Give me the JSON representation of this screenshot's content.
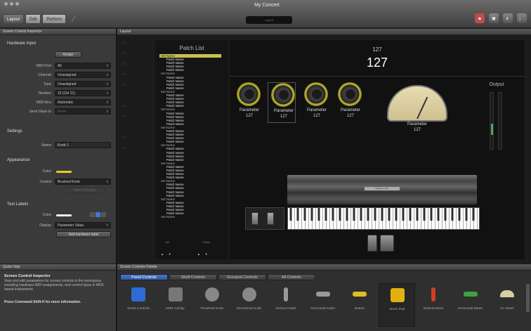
{
  "window": {
    "title": "My Concert",
    "lcd": "Layout"
  },
  "toolbar": {
    "modes": [
      "Layout",
      "Edit",
      "Perform"
    ],
    "active_mode": "Layout"
  },
  "inspector": {
    "title": "Screen Control Inspector",
    "hardware_input": {
      "heading": "Hardware Input",
      "assign_label": "Assign",
      "fields": [
        {
          "label": "MIDI Port:",
          "value": "All"
        },
        {
          "label": "Channel:",
          "value": "Unassigned"
        },
        {
          "label": "Type:",
          "value": "Unassigned"
        },
        {
          "label": "Number:",
          "value": "15 (Ctrl 21)"
        },
        {
          "label": "MIDI thru:",
          "value": "Automatic"
        },
        {
          "label": "Send Value to:",
          "value": "None"
        }
      ]
    },
    "settings": {
      "heading": "Settings",
      "name_label": "Name:",
      "name_value": "Knob 1"
    },
    "appearance": {
      "heading": "Appearance",
      "color_label": "Color:",
      "control_label": "Control:",
      "control_value": "Brushed Knob",
      "sub_button": "Select Display"
    },
    "text_labels": {
      "heading": "Text Labels",
      "color_label": "Color:",
      "display_label": "Display:",
      "display_value": "Parameter Value",
      "add_button": "Add hardware label"
    }
  },
  "layout": {
    "title": "Layout",
    "patch_list": {
      "title": "Patch List",
      "items": [
        {
          "text": "Set Name",
          "kind": "set",
          "selected": true
        },
        {
          "text": "Patch Name",
          "kind": "patch"
        },
        {
          "text": "Patch Name",
          "kind": "patch"
        },
        {
          "text": "Patch Name",
          "kind": "patch"
        },
        {
          "text": "Patch Name",
          "kind": "patch"
        },
        {
          "text": "Set Name",
          "kind": "set"
        },
        {
          "text": "Patch Name",
          "kind": "patch"
        },
        {
          "text": "Patch Name",
          "kind": "patch"
        },
        {
          "text": "Patch Name",
          "kind": "patch"
        },
        {
          "text": "Patch Name",
          "kind": "patch"
        },
        {
          "text": "Set Name",
          "kind": "set"
        },
        {
          "text": "Patch Name",
          "kind": "patch"
        },
        {
          "text": "Patch Name",
          "kind": "patch"
        },
        {
          "text": "Patch Name",
          "kind": "patch"
        },
        {
          "text": "Patch Name",
          "kind": "patch"
        },
        {
          "text": "Set Name",
          "kind": "set"
        },
        {
          "text": "Patch Name",
          "kind": "patch"
        },
        {
          "text": "Patch Name",
          "kind": "patch"
        },
        {
          "text": "Patch Name",
          "kind": "patch"
        },
        {
          "text": "Patch Name",
          "kind": "patch"
        },
        {
          "text": "Set Name",
          "kind": "set"
        },
        {
          "text": "Patch Name",
          "kind": "patch"
        },
        {
          "text": "Patch Name",
          "kind": "patch"
        },
        {
          "text": "Patch Name",
          "kind": "patch"
        },
        {
          "text": "Patch Name",
          "kind": "patch"
        },
        {
          "text": "Set Name",
          "kind": "set"
        },
        {
          "text": "Patch Name",
          "kind": "patch"
        },
        {
          "text": "Patch Name",
          "kind": "patch"
        },
        {
          "text": "Patch Name",
          "kind": "patch"
        },
        {
          "text": "Patch Name",
          "kind": "patch"
        },
        {
          "text": "Set Name",
          "kind": "set"
        },
        {
          "text": "Patch Name",
          "kind": "patch"
        },
        {
          "text": "Patch Name",
          "kind": "patch"
        },
        {
          "text": "Patch Name",
          "kind": "patch"
        },
        {
          "text": "Patch Name",
          "kind": "patch"
        },
        {
          "text": "Set Name",
          "kind": "set"
        },
        {
          "text": "Patch Name",
          "kind": "patch"
        },
        {
          "text": "Patch Name",
          "kind": "patch"
        },
        {
          "text": "Patch Name",
          "kind": "patch"
        },
        {
          "text": "Patch Name",
          "kind": "patch"
        },
        {
          "text": "Set Name",
          "kind": "set"
        },
        {
          "text": "Patch Name",
          "kind": "patch"
        },
        {
          "text": "Patch Name",
          "kind": "patch"
        },
        {
          "text": "Patch Name",
          "kind": "patch"
        },
        {
          "text": "Patch Name",
          "kind": "patch"
        },
        {
          "text": "Set Name",
          "kind": "set"
        }
      ],
      "set_nav_label": "Set",
      "patch_nav_label": "Patch"
    },
    "readout_small": "127",
    "readout_big": "127",
    "knobs": [
      {
        "name": "Parameter",
        "value": "127",
        "selected": false
      },
      {
        "name": "Parameter",
        "value": "127",
        "selected": true
      },
      {
        "name": "Parameter",
        "value": "127",
        "selected": false
      },
      {
        "name": "Parameter",
        "value": "127",
        "selected": false
      }
    ],
    "vu_meter": {
      "name": "Parameter",
      "value": "127"
    },
    "output_label": "Output",
    "pad_label": "Software Instr."
  },
  "quick_help": {
    "title": "Quick Help",
    "heading": "Screen Control Inspector",
    "text": "View and edit parameters for screen controls in the workspace, including hardware MIDI assignments, and control types in MIDI-based instruments.",
    "bold": "Press Command-Shift-H for more information."
  },
  "palette": {
    "title": "Screen Controls Palette",
    "tabs": [
      "Panel Controls",
      "Shelf Controls",
      "Grouped Controls",
      "All Controls"
    ],
    "active_tab": "Panel Controls",
    "items": [
      {
        "name": "Smart Controls",
        "icon": "smart-controls-icon",
        "color": "#2f6bd6"
      },
      {
        "name": "MIDI Activity",
        "icon": "midi-activity-icon",
        "color": "#777777"
      },
      {
        "name": "Pinwheel Knob",
        "icon": "pinwheel-knob-icon",
        "color": "#888888"
      },
      {
        "name": "Directional Knob",
        "icon": "directional-knob-icon",
        "color": "#888888"
      },
      {
        "name": "Vertical Fader",
        "icon": "vertical-fader-icon",
        "color": "#999999"
      },
      {
        "name": "Horizontal Fader",
        "icon": "horizontal-fader-icon",
        "color": "#999999"
      },
      {
        "name": "Button",
        "icon": "button-icon",
        "color": "#e0c020"
      },
      {
        "name": "Drum Pad",
        "icon": "drum-pad-icon",
        "color": "#e0b010"
      },
      {
        "name": "Vertical Meter",
        "icon": "vertical-meter-icon",
        "color": "#d04020"
      },
      {
        "name": "Horizontal Meter",
        "icon": "horizontal-meter-icon",
        "color": "#40a040"
      },
      {
        "name": "VU Meter",
        "icon": "vu-meter-icon",
        "color": "#d8cfa0"
      }
    ]
  }
}
